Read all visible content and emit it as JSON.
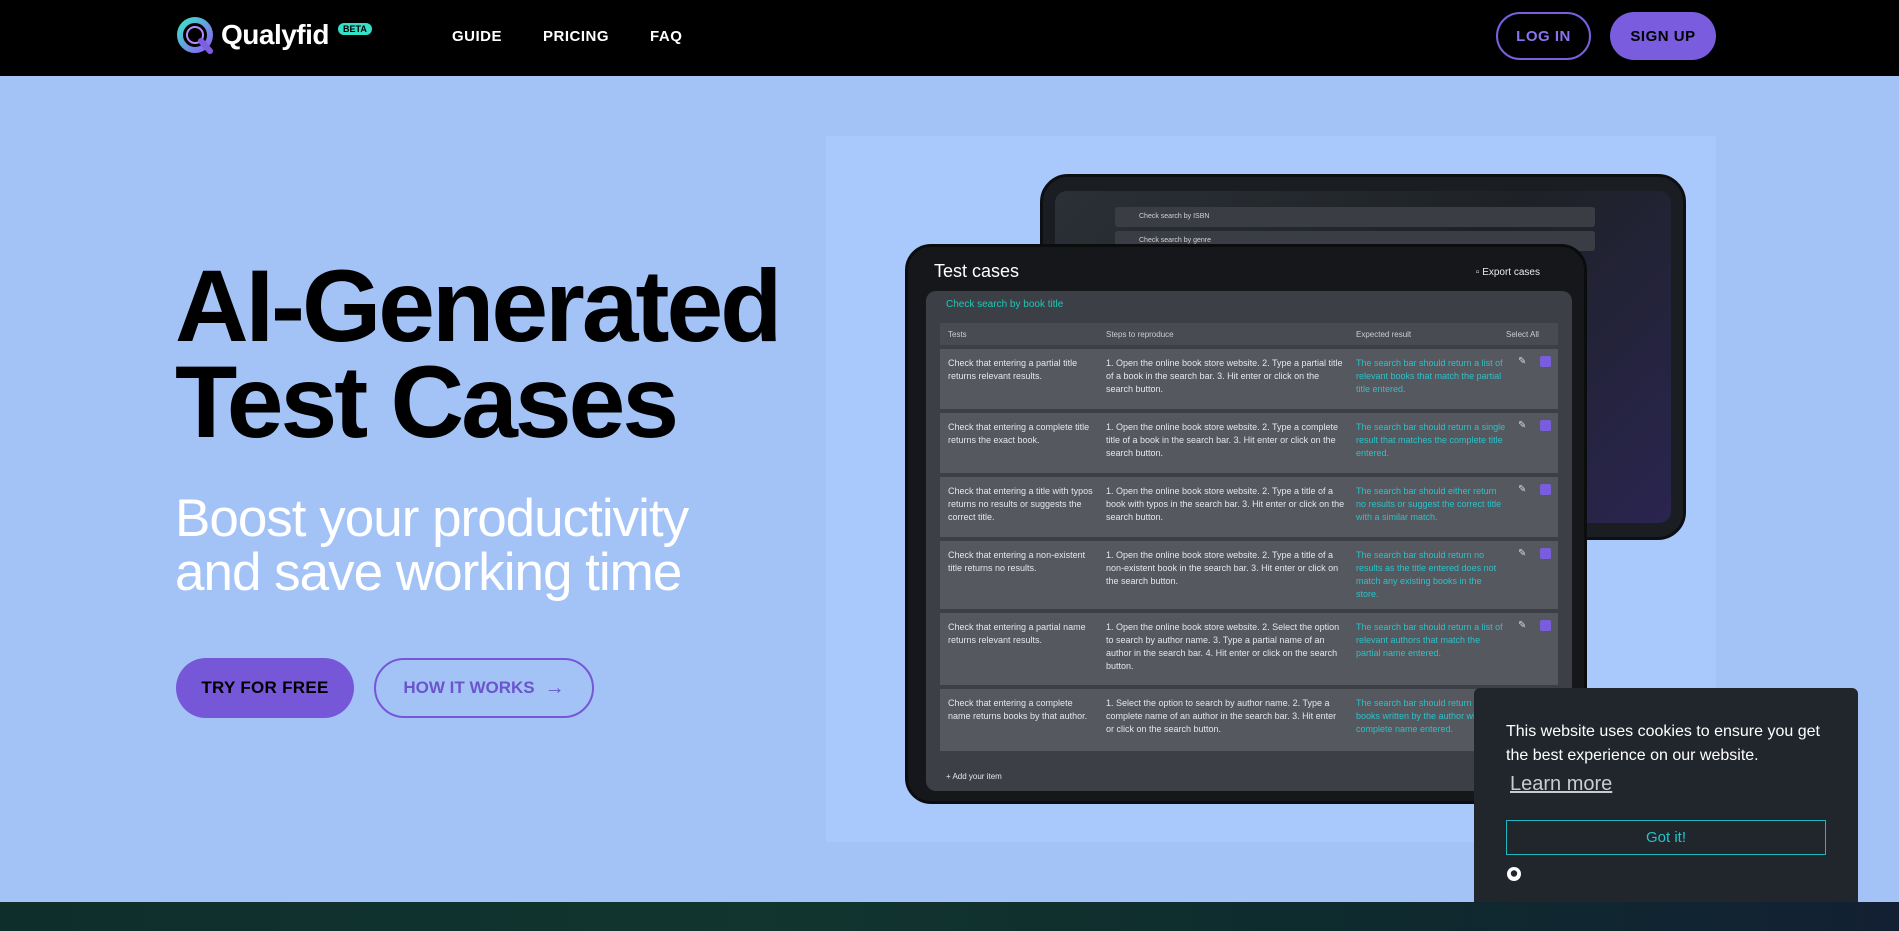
{
  "nav": {
    "brand": "Qualyfid",
    "beta": "BETA",
    "links": [
      "GUIDE",
      "PRICING",
      "FAQ"
    ],
    "login": "LOG IN",
    "signup": "SIGN UP"
  },
  "hero": {
    "title_line1": "AI-Generated",
    "title_line2": "Test Cases",
    "subtitle_line1": "Boost your productivity",
    "subtitle_line2": "and save working time",
    "try_label": "TRY FOR FREE",
    "how_label": "HOW IT WORKS"
  },
  "mockup": {
    "back_rows": [
      "Check search by ISBN",
      "Check search by genre"
    ],
    "title": "Test cases",
    "export": "Export cases",
    "search_title": "Check search by book title",
    "headers": {
      "tests": "Tests",
      "steps": "Steps to reproduce",
      "expected": "Expected result",
      "select_all": "Select All"
    },
    "rows": [
      {
        "test": "Check that entering a partial title returns relevant results.",
        "steps": "1. Open the online book store website. 2. Type a partial title of a book in the search bar. 3. Hit enter or click on the search button.",
        "expected": "The search bar should return a list of relevant books that match the partial title entered."
      },
      {
        "test": "Check that entering a complete title returns the exact book.",
        "steps": "1. Open the online book store website. 2. Type a complete title of a book in the search bar. 3. Hit enter or click on the search button.",
        "expected": "The search bar should return a single result that matches the complete title entered."
      },
      {
        "test": "Check that entering a title with typos returns no results or suggests the correct title.",
        "steps": "1. Open the online book store website. 2. Type a title of a book with typos in the search bar. 3. Hit enter or click on the search button.",
        "expected": "The search bar should either return no results or suggest the correct title with a similar match."
      },
      {
        "test": "Check that entering a non-existent title returns no results.",
        "steps": "1. Open the online book store website. 2. Type a title of a non-existent book in the search bar. 3. Hit enter or click on the search button.",
        "expected": "The search bar should return no results as the title entered does not match any existing books in the store."
      },
      {
        "test": "Check that entering a partial name returns relevant results.",
        "steps": "1. Open the online book store website. 2. Select the option to search by author name. 3. Type a partial name of an author in the search bar. 4. Hit enter or click on the search button.",
        "expected": "The search bar should return a list of relevant authors that match the partial name entered."
      },
      {
        "test": "Check that entering a complete name returns books by that author.",
        "steps": "1. Select the option to search by author name. 2. Type a complete name of an author in the search bar. 3. Hit enter or click on the search button.",
        "expected": "The search bar should return a list of books written by the author with complete name entered."
      }
    ],
    "add_item": "+ Add your item"
  },
  "cookie": {
    "text": "This website uses cookies to ensure you get the best experience on our website.",
    "learn_more": "Learn more",
    "accept": "Got it!"
  }
}
